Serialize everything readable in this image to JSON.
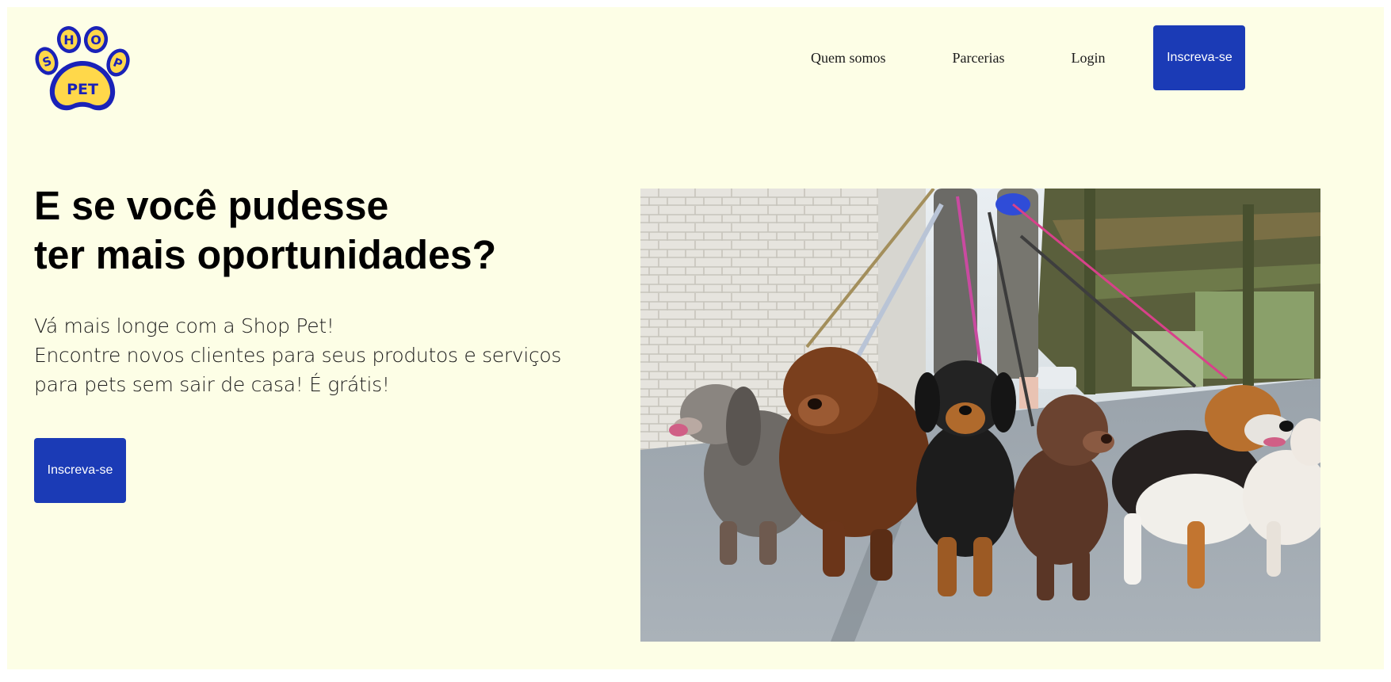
{
  "logo": {
    "top_text": "SHOP",
    "bottom_text": "PET",
    "fill_color": "#ffd84a",
    "outline_color": "#1a22b8"
  },
  "nav": {
    "items": [
      {
        "label": "Quem somos"
      },
      {
        "label": "Parcerias"
      },
      {
        "label": "Login"
      }
    ],
    "cta_label": "Inscreva-se"
  },
  "hero": {
    "title_line1": "E se você pudesse",
    "title_line2": "ter mais oportunidades?",
    "text_line1": "Vá mais longe com a Shop Pet!",
    "text_line2": "Encontre novos clientes para seus produtos e serviços",
    "text_line3": "para pets sem sair de casa! É grátis!",
    "cta_label": "Inscreva-se",
    "image_subject": "dogs-on-leashes-photo"
  },
  "colors": {
    "page_background": "#fdfee6",
    "button_background": "#1b3bb6",
    "button_text": "#ffffff"
  }
}
